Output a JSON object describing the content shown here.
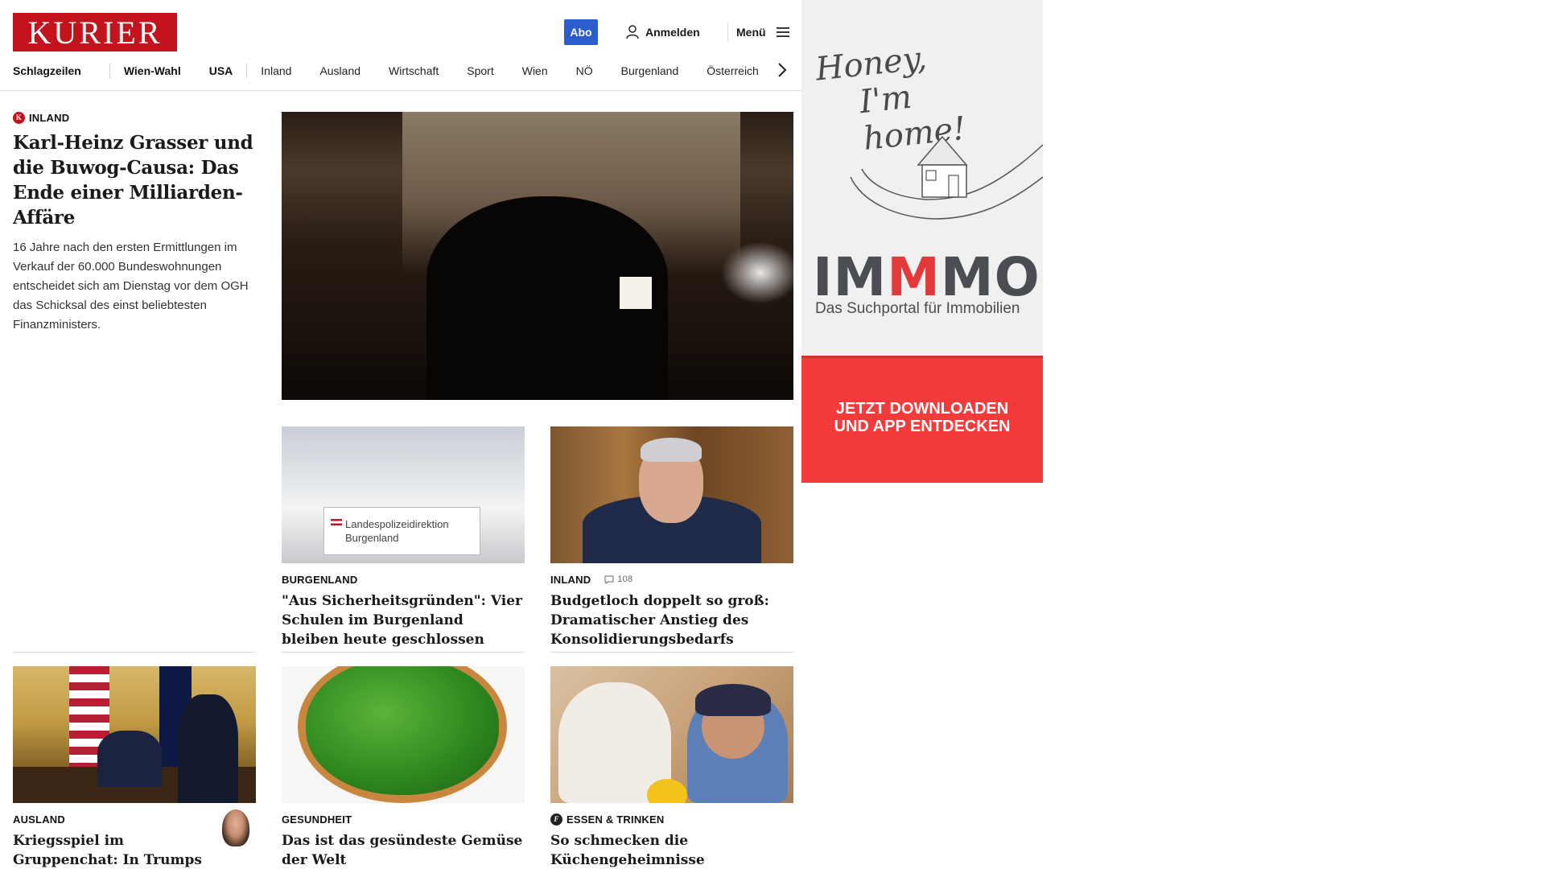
{
  "header": {
    "logo": "KURIER",
    "abo_label": "Abo",
    "login_label": "Anmelden",
    "menu_label": "Menü"
  },
  "nav": {
    "items": [
      {
        "label": "Schlagzeilen",
        "bold": true
      },
      {
        "label": "Wien-Wahl",
        "bold": true
      },
      {
        "label": "USA",
        "bold": true
      },
      {
        "label": "Inland",
        "bold": false
      },
      {
        "label": "Ausland",
        "bold": false
      },
      {
        "label": "Wirtschaft",
        "bold": false
      },
      {
        "label": "Sport",
        "bold": false
      },
      {
        "label": "Wien",
        "bold": false
      },
      {
        "label": "NÖ",
        "bold": false
      },
      {
        "label": "Burgenland",
        "bold": false
      },
      {
        "label": "Österreich",
        "bold": false
      }
    ]
  },
  "lead": {
    "kicker": "INLAND",
    "badge": "K",
    "headline": "Karl-Heinz Grasser und die Buwog-Causa: Das Ende einer Milliarden-Affäre",
    "teaser": "16 Jahre nach den ersten Ermittlungen im Verkauf der 60.000 Bundeswohnungen entscheidet sich am Dienstag vor dem OGH das Schicksal des einst beliebtesten Finanzministers."
  },
  "cards": [
    {
      "kicker": "BURGENLAND",
      "headline": "\"Aus Sicherheitsgründen\": Vier Schulen im Burgenland bleiben heute geschlossen",
      "sign_line1": "Landespolizeidirektion",
      "sign_line2": "Burgenland"
    },
    {
      "kicker": "INLAND",
      "comments": "108",
      "headline": "Budgetloch doppelt so groß: Dramatischer Anstieg des Konsolidierungsbedarfs"
    },
    {
      "kicker": "AUSLAND",
      "headline": "Kriegsspiel im Gruppenchat: In Trumps Team müssen jetzt Köpfe"
    },
    {
      "kicker": "GESUNDHEIT",
      "headline": "Das ist das gesündeste Gemüse der Welt"
    },
    {
      "kicker": "ESSEN & TRINKEN",
      "badge": "f",
      "headline": "So schmecken die Küchengeheimnisse griechischer Omas"
    }
  ],
  "ad": {
    "script_line1": "Honey,",
    "script_line2": "I'm home!",
    "brand_a": "IM",
    "brand_b": "M",
    "brand_c": "MO",
    "tagline": "Das Suchportal für Immobilien",
    "cta_line1": "JETZT DOWNLOADEN",
    "cta_line2": "UND APP ENTDECKEN"
  },
  "colors": {
    "brand_red": "#c3141e",
    "abo_blue": "#2b5ecc",
    "ad_red": "#f43a3a"
  }
}
